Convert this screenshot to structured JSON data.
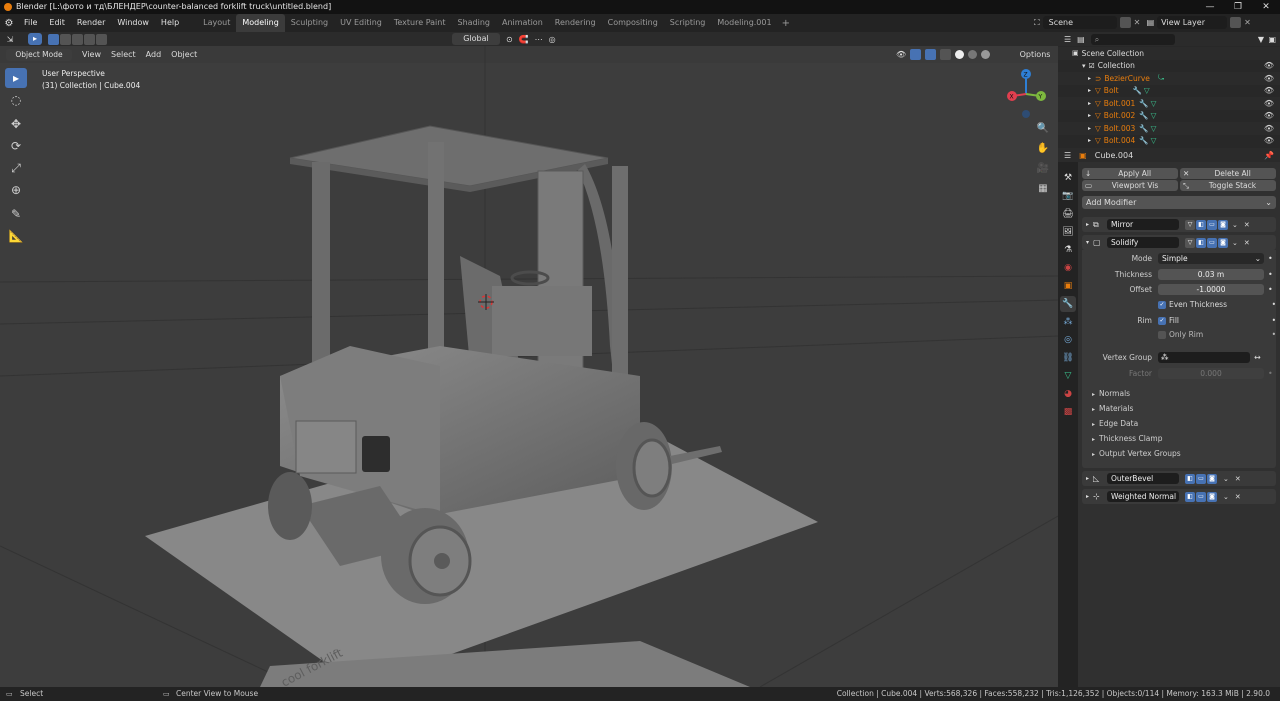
{
  "window": {
    "title": "Blender [L:\\фото и тд\\БЛЕНДЕР\\counter-balanced forklift truck\\untitled.blend]",
    "minimize": "—",
    "maximize": "❐",
    "close": "✕"
  },
  "menu": [
    "File",
    "Edit",
    "Render",
    "Window",
    "Help"
  ],
  "workspaces": [
    "Layout",
    "Modeling",
    "Sculpting",
    "UV Editing",
    "Texture Paint",
    "Shading",
    "Animation",
    "Rendering",
    "Compositing",
    "Scripting",
    "Modeling.001"
  ],
  "active_workspace": "Modeling",
  "scene": {
    "name": "Scene",
    "view_layer": "View Layer"
  },
  "viewport_header": {
    "mode": "Object Mode",
    "menus": [
      "View",
      "Select",
      "Add",
      "Object"
    ],
    "transform_orientation": "Global",
    "options": "Options"
  },
  "viewport": {
    "perspective": "User Perspective",
    "collection_info": "(31) Collection | Cube.004",
    "gizmo": {
      "x": "X",
      "y": "Y",
      "z": "Z"
    },
    "floor_text": "cool forklift"
  },
  "outliner": {
    "search_placeholder": "",
    "root": "Scene Collection",
    "collection": "Collection",
    "items": [
      "BezierCurve",
      "Bolt",
      "Bolt.001",
      "Bolt.002",
      "Bolt.003",
      "Bolt.004"
    ]
  },
  "properties": {
    "object_name": "Cube.004",
    "apply_all": "Apply All",
    "delete_all": "Delete All",
    "viewport_vis": "Viewport Vis",
    "toggle_stack": "Toggle Stack",
    "add_modifier": "Add Modifier",
    "modifiers": [
      "Mirror",
      "Solidify",
      "OuterBevel",
      "Weighted Normal"
    ],
    "solidify": {
      "mode_label": "Mode",
      "mode_value": "Simple",
      "thickness_label": "Thickness",
      "thickness_value": "0.03 m",
      "offset_label": "Offset",
      "offset_value": "-1.0000",
      "even_thickness": "Even Thickness",
      "rim_label": "Rim",
      "fill": "Fill",
      "only_rim": "Only Rim",
      "vertex_group_label": "Vertex Group",
      "factor_label": "Factor",
      "factor_value": "0.000"
    },
    "subpanels": [
      "Normals",
      "Materials",
      "Edge Data",
      "Thickness Clamp",
      "Output Vertex Groups"
    ]
  },
  "statusbar": {
    "left": "Select",
    "center": "Center View to Mouse",
    "right": "Collection | Cube.004 | Verts:568,326 | Faces:558,232 | Tris:1,126,352 | Objects:0/114 | Memory: 163.3 MiB | 2.90.0"
  },
  "colors": {
    "accent": "#4772b3",
    "orange": "#e87d0d",
    "x_axis": "#e23f4f",
    "y_axis": "#7db83e",
    "z_axis": "#2e7fd5"
  }
}
